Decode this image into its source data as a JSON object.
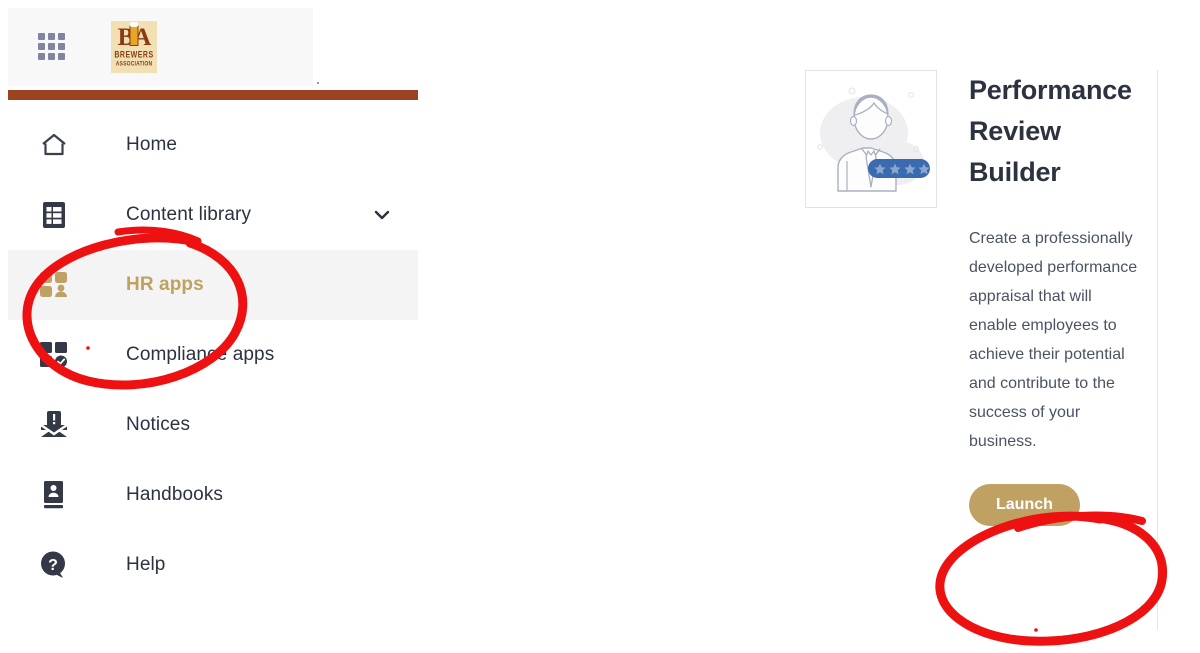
{
  "brand": {
    "logo_initials": "BA",
    "logo_line1": "BREWERS",
    "logo_line2": "ASSOCIATION",
    "accent_gold": "#bfa263",
    "accent_brown": "#9c4221",
    "annotation_color": "#ee1111"
  },
  "header": {
    "waffle_icon": "app-grid-icon",
    "logo_icon": "brewers-association-logo"
  },
  "sidebar": {
    "items": [
      {
        "label": "Home",
        "icon": "home-icon",
        "active": false,
        "expandable": false
      },
      {
        "label": "Content library",
        "icon": "list-document-icon",
        "active": false,
        "expandable": true
      },
      {
        "label": "HR apps",
        "icon": "hr-apps-grid-person-icon",
        "active": true,
        "expandable": false
      },
      {
        "label": "Compliance apps",
        "icon": "compliance-grid-check-icon",
        "active": false,
        "expandable": false
      },
      {
        "label": "Notices",
        "icon": "envelope-alert-icon",
        "active": false,
        "expandable": false
      },
      {
        "label": "Handbooks",
        "icon": "book-person-icon",
        "active": false,
        "expandable": false
      },
      {
        "label": "Help",
        "icon": "question-mark-icon",
        "active": false,
        "expandable": false
      }
    ]
  },
  "app_card": {
    "thumbnail_icon": "performance-review-person-stars-illustration",
    "star_count": 4,
    "title": "Performance Review Builder",
    "description": "Create a professionally developed performance appraisal that will enable employees to achieve their potential and contribute to the success of your business.",
    "launch_label": "Launch"
  },
  "annotations": [
    {
      "name": "hr-apps-circle",
      "shape": "ellipse"
    },
    {
      "name": "launch-circle",
      "shape": "ellipse"
    }
  ]
}
